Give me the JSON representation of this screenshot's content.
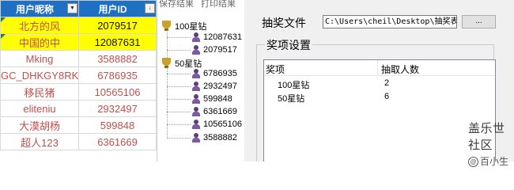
{
  "spreadsheet": {
    "headers": [
      "用户昵称",
      "用户ID"
    ],
    "rows": [
      {
        "name": "北方的风",
        "id": "2079517"
      },
      {
        "name": "中国的中",
        "id": "12087631"
      },
      {
        "name": "Mking",
        "id": "3588882"
      },
      {
        "name": "GC_DHKGY8RK",
        "id": "6786935"
      },
      {
        "name": "移民猪",
        "id": "10565106"
      },
      {
        "name": "eliteniu",
        "id": "2932497"
      },
      {
        "name": "大漠胡杨",
        "id": "599848"
      },
      {
        "name": "超人123",
        "id": "6361669"
      }
    ],
    "highlight_color": "#ffff00",
    "header_color": "#1f6fc2",
    "text_color": "#c0504d"
  },
  "tree_panel": {
    "tabs": [
      "保存结果",
      "打印结果"
    ],
    "groups": [
      {
        "label": "100星钻",
        "icon": "trophy-icon",
        "members": [
          "12087631",
          "2079517"
        ]
      },
      {
        "label": "50星钻",
        "icon": "trophy-icon",
        "members": [
          "6786935",
          "2932497",
          "599848",
          "6361669",
          "10565106",
          "3588882"
        ]
      }
    ]
  },
  "settings_panel": {
    "file_label": "抽奖文件",
    "file_path": "C:\\Users\\cheil\\Desktop\\抽奖表格",
    "browse_label": "...",
    "group_title": "奖项设置",
    "columns": [
      "奖项",
      "抽取人数"
    ],
    "prizes": [
      {
        "name": "100星钻",
        "count": "2"
      },
      {
        "name": "50星钻",
        "count": "6"
      }
    ]
  },
  "watermark": {
    "title": "盖乐世社区",
    "subtitle": "百小生"
  }
}
